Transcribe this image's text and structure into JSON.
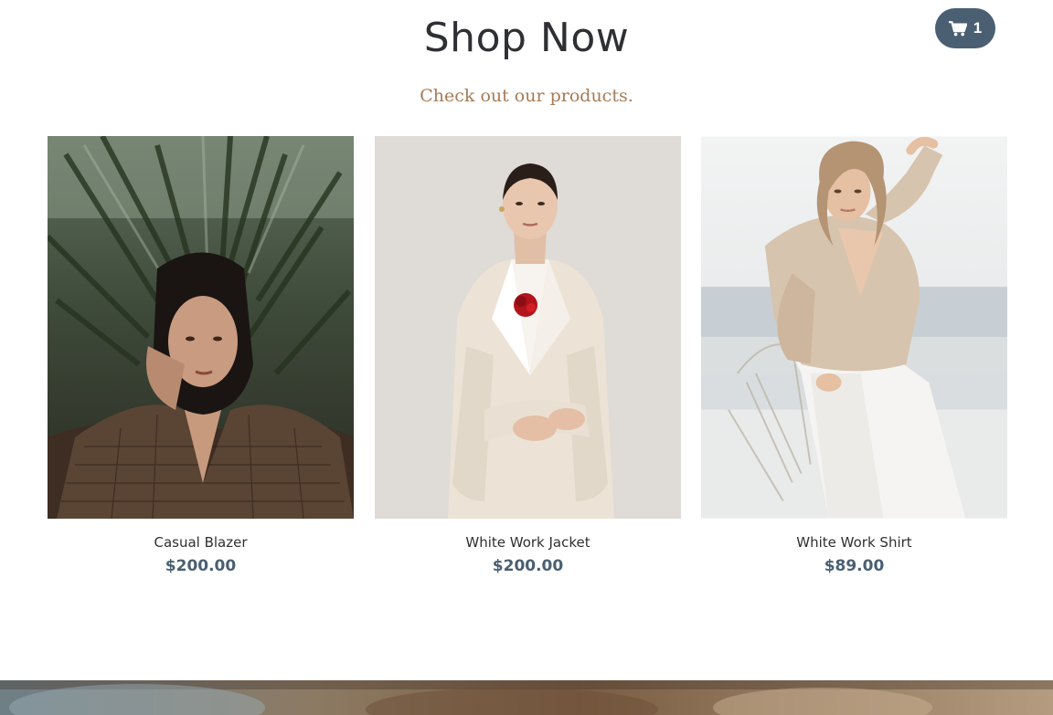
{
  "header": {
    "title": "Shop Now",
    "subtitle": "Check out our products."
  },
  "cart": {
    "icon": "cart-icon",
    "count": "1"
  },
  "products": [
    {
      "name": "Casual Blazer",
      "price": "$200.00"
    },
    {
      "name": "White Work Jacket",
      "price": "$200.00"
    },
    {
      "name": "White Work Shirt",
      "price": "$89.00"
    }
  ],
  "colors": {
    "accent": "#4a5f72",
    "subtitle": "#a87a55",
    "text": "#2f3033"
  }
}
